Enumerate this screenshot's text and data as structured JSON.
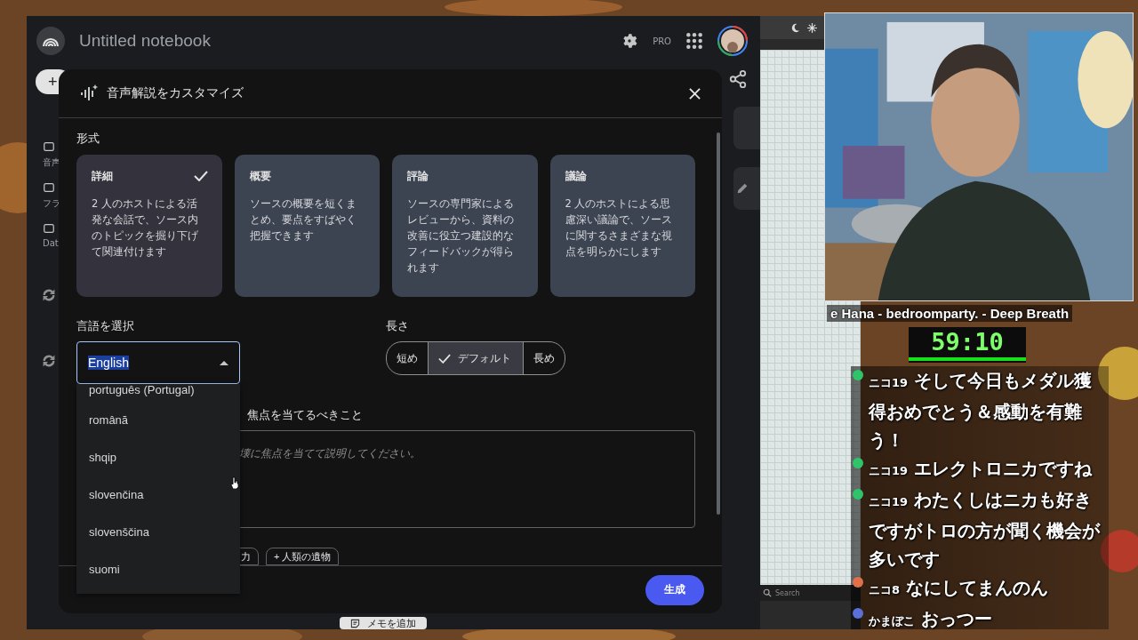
{
  "app": {
    "title": "Untitled notebook",
    "plan_badge": "PRO",
    "add_button": "+",
    "sidebar": [
      {
        "label": "音声"
      },
      {
        "label": "フラ"
      },
      {
        "label": "Dat"
      }
    ],
    "add_note_button": "メモを追加"
  },
  "dialog": {
    "title": "音声解説をカスタマイズ",
    "format_label": "形式",
    "formats": [
      {
        "title": "詳細",
        "description": "2 人のホストによる活発な会話で、ソース内のトピックを掘り下げて関連付けます",
        "selected": true
      },
      {
        "title": "概要",
        "description": "ソースの概要を短くまとめ、要点をすばやく把握できます",
        "selected": false
      },
      {
        "title": "評論",
        "description": "ソースの専門家によるレビューから、資料の改善に役立つ建設的なフィードバックが得られます",
        "selected": false
      },
      {
        "title": "議論",
        "description": "2 人のホストによる思慮深い議論で、ソースに関するさまざまな視点を明らかにします",
        "selected": false
      }
    ],
    "language_label": "言語を選択",
    "language_value": "English",
    "language_options": [
      "português (Portugal)",
      "română",
      "shqip",
      "slovenčina",
      "slovenščina",
      "suomi"
    ],
    "length_label": "長さ",
    "lengths": [
      {
        "label": "短め",
        "selected": false
      },
      {
        "label": "デフォルト",
        "selected": true
      },
      {
        "label": "長め",
        "selected": false
      }
    ],
    "focus_label": "焦点を当てるべきこと",
    "focus_placeholder": "壊に焦点を当てて説明してください。",
    "suggestion_chips": [
      "力",
      "+ 人類の遺物"
    ],
    "generate_button": "生成"
  },
  "side_panel": {
    "search_placeholder": "Search"
  },
  "stream": {
    "now_playing": "e Hana - bedroomparty. - Deep Breath",
    "timer": "59:10",
    "chat": [
      {
        "color": "#2ec46a",
        "user": "ニコ19",
        "message": "そして今日もメダル獲得おめでとう＆感動を有難う！"
      },
      {
        "color": "#2ec46a",
        "user": "ニコ19",
        "message": "エレクトロニカですね"
      },
      {
        "color": "#2ec46a",
        "user": "ニコ19",
        "message": "わたくしはニカも好きですがトロの方が聞く機会が多いです"
      },
      {
        "color": "#e0704a",
        "user": "ニコ8",
        "message": "なにしてまんのん"
      },
      {
        "color": "#5a6fd8",
        "user": "かまぼこ",
        "message": "おっつー"
      }
    ]
  }
}
